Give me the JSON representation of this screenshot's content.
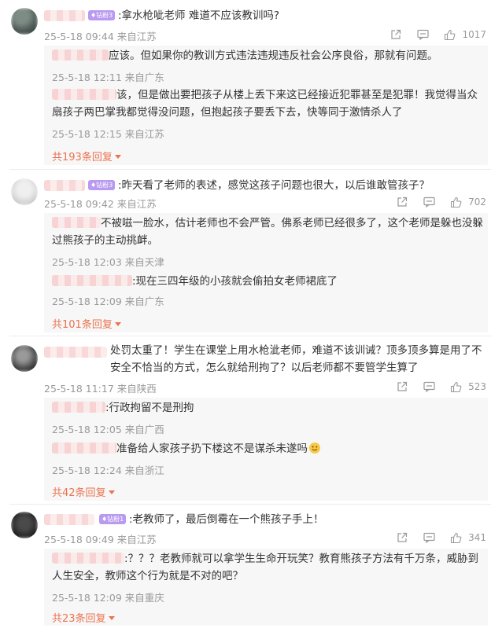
{
  "comments": [
    {
      "badge": "钻粉3",
      "text": ":拿水枪呲老师 难道不应该教训吗?",
      "meta": "25-5-18 09:44 来自江苏",
      "likes": "1017",
      "replies": [
        {
          "text": "应该。但如果你的教训方式违法违规违反社会公序良俗，那就有问题。",
          "meta": "25-5-18 12:11 来自广东"
        },
        {
          "text": "该，但是做出要把孩子从楼上丢下来这已经接近犯罪甚至是犯罪！我觉得当众扇孩子两巴掌我都觉得没问题，但抱起孩子要丢下去，快等同于激情杀人了",
          "meta": "25-5-18 12:15 来自江苏"
        }
      ],
      "more": "共193条回复"
    },
    {
      "badge": "钻粉3",
      "text": ":昨天看了老师的表述，感觉这孩子问题也很大，以后谁敢管孩子？",
      "meta": "25-5-18 09:42 来自江苏",
      "likes": "702",
      "replies": [
        {
          "text": "不被嗞一脸水，估计老师也不会严管。佛系老师已经很多了，这个老师是躲也没躲过熊孩子的主动挑衅。",
          "meta": "25-5-18 12:03 来自天津"
        },
        {
          "text": ":现在三四年级的小孩就会偷拍女老师裙底了",
          "meta": "25-5-18 12:09 来自广东"
        }
      ],
      "more": "共101条回复"
    },
    {
      "badge": "",
      "text": "处罚太重了！学生在课堂上用水枪泚老师，难道不该训诫？顶多顶多算是用了不安全不恰当的方式，怎么就给刑拘了？以后老师都不要管学生算了",
      "meta": "25-5-18 11:17 来自陕西",
      "likes": "523",
      "replies": [
        {
          "text": ":行政拘留不是刑拘",
          "meta": "25-5-18 12:05 来自广西"
        },
        {
          "text": "准备给人家孩子扔下楼这不是谋杀未遂吗",
          "meta": "25-5-18 12:24 来自浙江"
        }
      ],
      "more": "共42条回复"
    },
    {
      "badge": "钻粉1",
      "text": ":老教师了，最后倒霉在一个熊孩子手上！",
      "meta": "25-5-18 09:49 来自江苏",
      "likes": "341",
      "replies": [
        {
          "text": ":？？？老教师就可以拿学生生命开玩笑？教育熊孩子方法有千万条，威胁到人生安全，教师这个行为就是不对的吧？",
          "meta": "25-5-18 12:09 来自重庆"
        }
      ],
      "more": "共23条回复"
    }
  ],
  "icons": {
    "share": "share-icon",
    "comment": "comment-icon",
    "like": "thumbs-up-icon",
    "more_caret": "caret-down-icon",
    "badge": "diamond-icon",
    "emoji": "smile-emoji-icon"
  },
  "colors": {
    "accent": "#eb7350",
    "meta": "#999999",
    "badge": "#b99af0",
    "reply_bg": "#f7f7f7"
  }
}
